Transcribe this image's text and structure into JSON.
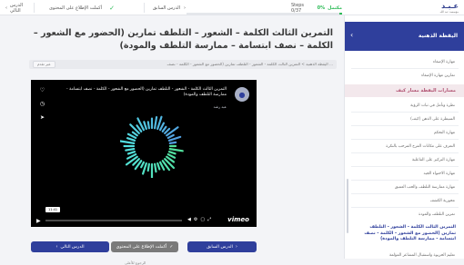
{
  "topbar": {
    "progress_pct": "0%",
    "progress_label": "مكتمل",
    "steps": "Steps 0/37",
    "progress_fraction": 0.02,
    "prev_label": "الدرس السابق",
    "complete_label": "أكملت الإطلاع على المحتوى",
    "next_label": "الدرس التالي",
    "logo_main": "عـبـد",
    "logo_sub": "مؤسسة عبد الله"
  },
  "sidebar": {
    "header_title": "اليقظة الذهنية",
    "items_top": [
      "مهارة الإصغاء",
      "تمارين مهارة الإصغاء"
    ],
    "section_title": "مسارات اليقظة مسار كيف",
    "items": [
      "نظرة وتأمل في ثبات الرؤية",
      "السيطرة على الذهن (كيف)",
      "مهارة التحكم",
      "التعرف على مكانات الفرح المرحب بالنكرة",
      "مهارة التركيز على الفاعلية",
      "مهارة الاحتواء الجيد",
      "مهارة ممارسة التلطف والحب العميق",
      "محورية الكشف",
      "تمرين التلطف والمودة"
    ],
    "active_item": "التمرين الثالث الكلمة - الشعور - التلطف تمارين (الحضور مع الشعور - الكلمة - نصف ابتسامة - ممارسة التلطف والمودة)",
    "last_item": "تعليم الحريوة واستقبال المشاعر المؤلمة"
  },
  "main": {
    "title": "التمرين الثالث الكلمة – الشعور – التلطف تمارين (الحضور مع الشعور – الكلمة – نصف ابتسامة – ممارسة التلطف والمودة)",
    "breadcrumb": "اليقظة الذهنية > التمرين الثالث الكلمة - الشعور - التلطف تمارين (الحضور مع الشعور - الكلمة - نصف ...",
    "breadcrumb_tag": "غير تقدم",
    "video": {
      "title": "التمرين الثالث الكلمة - الشعور - التلطف تمارين (الحضور مع الشعور - الكلمة - نصف ابتسامة - ممارسة التلطف والمودة)",
      "author": "عبد رشد",
      "time": "11:41",
      "played_fraction": 0.0,
      "brand": "vimeo"
    },
    "btn_next": "الدرس التالي",
    "btn_complete": "أكملت الإطلاع على المحتوى",
    "btn_prev": "الدرس السابق",
    "footer": "الرجوع للأعلى"
  }
}
